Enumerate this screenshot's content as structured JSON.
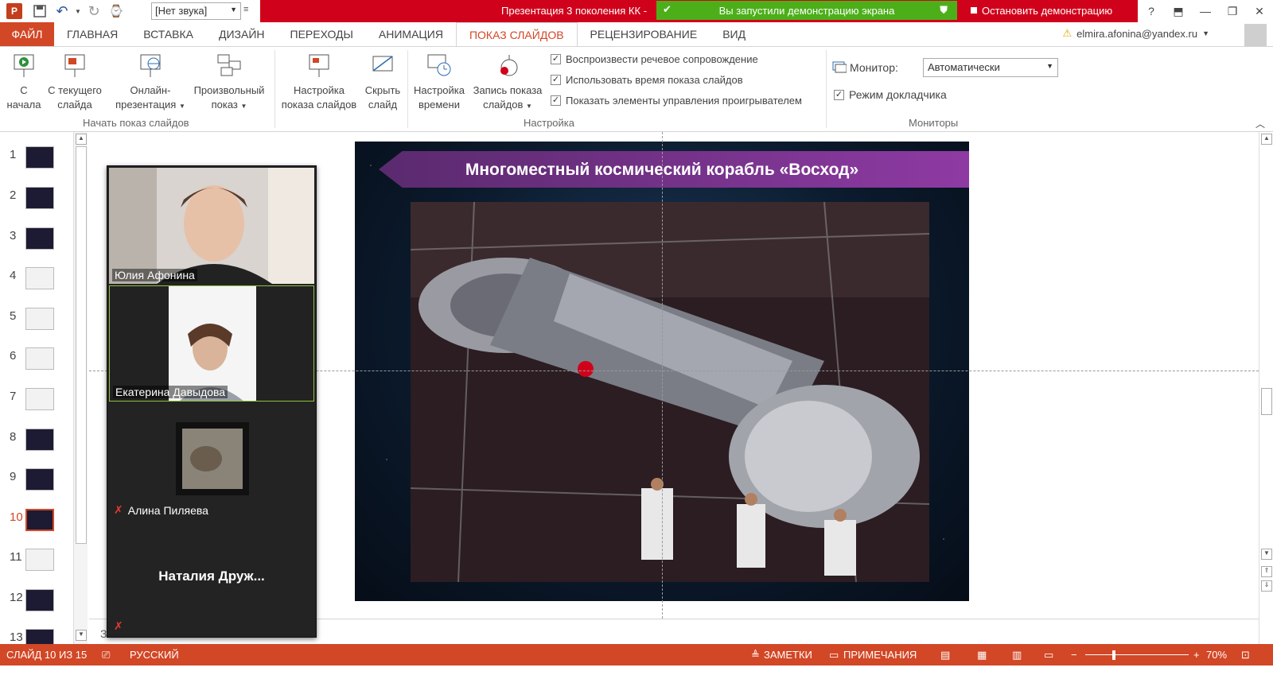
{
  "titlebar": {
    "sound_select": "[Нет звука]",
    "doc_title": "Презентация 3 поколения КК -",
    "share_status": "Вы запустили демонстрацию экрана",
    "stop_button": "Остановить демонстрацию",
    "help": "?"
  },
  "tabs": [
    "ФАЙЛ",
    "ГЛАВНАЯ",
    "ВСТАВКА",
    "ДИЗАЙН",
    "ПЕРЕХОДЫ",
    "АНИМАЦИЯ",
    "ПОКАЗ СЛАЙДОВ",
    "РЕЦЕНЗИРОВАНИЕ",
    "ВИД"
  ],
  "user": {
    "email": "elmira.afonina@yandex.ru"
  },
  "ribbon": {
    "start_group": {
      "label": "Начать показ слайдов",
      "from_start_1": "С",
      "from_start_2": "начала",
      "from_current_1": "С текущего",
      "from_current_2": "слайда",
      "online_1": "Онлайн-",
      "online_2": "презентация",
      "custom_1": "Произвольный",
      "custom_2": "показ"
    },
    "setup_group": {
      "label": "Настройка",
      "setup_show_1": "Настройка",
      "setup_show_2": "показа слайдов",
      "hide_1": "Скрыть",
      "hide_2": "слайд",
      "rehearse_1": "Настройка",
      "rehearse_2": "времени",
      "record_1": "Запись показа",
      "record_2": "слайдов",
      "chk1": "Воспроизвести речевое сопровождение",
      "chk2": "Использовать время показа слайдов",
      "chk3": "Показать элементы управления проигрывателем"
    },
    "monitors_group": {
      "label": "Мониторы",
      "monitor_label": "Монитор:",
      "monitor_value": "Автоматически",
      "presenter_view": "Режим докладчика"
    }
  },
  "thumbnails": [
    "1",
    "2",
    "3",
    "4",
    "5",
    "6",
    "7",
    "8",
    "9",
    "10",
    "11",
    "12",
    "13"
  ],
  "active_slide": "10",
  "slide": {
    "title": "Многоместный космический корабль «Восход»"
  },
  "video": {
    "p1": "Юлия Афонина",
    "p2": "Екатерина Давыдова",
    "p3": "Алина Пиляева",
    "p4": "Наталия  Друж..."
  },
  "notes_placeholder": "З",
  "status": {
    "slide_of": "СЛАЙД 10 ИЗ 15",
    "language": "РУССКИЙ",
    "notes": "ЗАМЕТКИ",
    "comments": "ПРИМЕЧАНИЯ",
    "zoom": "70%"
  },
  "colors": {
    "accent": "#d24726",
    "share_green": "#4caf1a",
    "alert_red": "#d0021b"
  }
}
